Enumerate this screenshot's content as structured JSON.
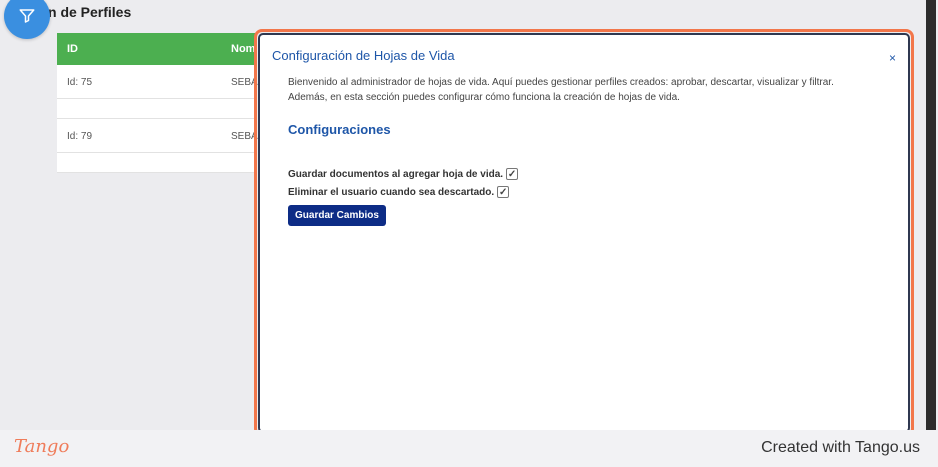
{
  "page": {
    "title": "n de Perfiles"
  },
  "table": {
    "headers": {
      "id": "ID",
      "name": "Nom"
    },
    "rows": [
      {
        "id": "Id: 75",
        "name": "SEBA"
      },
      {
        "id": "Id: 79",
        "name": "SEBA"
      }
    ]
  },
  "modal": {
    "title": "Configuración de Hojas de Vida",
    "close": "×",
    "intro_line1": "Bienvenido al administrador de hojas de vida. Aquí puedes gestionar perfiles creados: aprobar, descartar, visualizar y filtrar.",
    "intro_line2": "Además, en esta sección puedes configurar cómo funciona la creación de hojas de vida.",
    "section_title": "Configuraciones",
    "options": [
      {
        "label": "Guardar documentos al agregar hoja de vida.",
        "checked": "✓"
      },
      {
        "label": "Eliminar el usuario cuando sea descartado.",
        "checked": "✓"
      }
    ],
    "save_button": "Guardar Cambios"
  },
  "footer": {
    "logo": "Tango",
    "created_with": "Created with Tango.us"
  },
  "colors": {
    "accent": "#1e56a8",
    "header_green": "#4caf50",
    "highlight": "#f2764a",
    "button": "#0d2c86",
    "fab": "#3a8fe0"
  },
  "icons": {
    "fab": "filter-icon"
  }
}
